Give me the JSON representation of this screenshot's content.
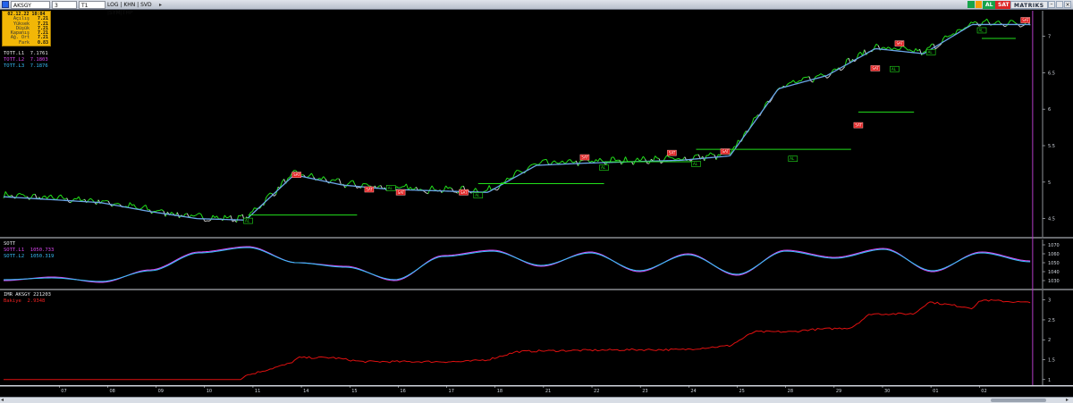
{
  "toolbar": {
    "symbol": "AKSGY",
    "field_a": "3",
    "field_b": "T1",
    "modes": "LOG | KHN | SVD |SYM|THP",
    "buy": "AL",
    "sell": "SAT",
    "brand": "MATRIKS"
  },
  "info": {
    "datetime": "02.12.22 10:04",
    "rows": [
      {
        "k": "Açılış",
        "v": "7.21"
      },
      {
        "k": "Yüksek",
        "v": "7.21"
      },
      {
        "k": "Düşük",
        "v": "7.21"
      },
      {
        "k": "Kapanış",
        "v": "7.21"
      },
      {
        "k": "Ağ. Ort",
        "v": "7.21"
      },
      {
        "k": "Fark",
        "v": "0.83"
      }
    ]
  },
  "legend_main": [
    {
      "name": "TOTT.L1",
      "value": "7.1761",
      "color": "#e8e8e8"
    },
    {
      "name": "TOTT.L2",
      "value": "7.1803",
      "color": "#d946ef"
    },
    {
      "name": "TOTT.L3",
      "value": "7.1876",
      "color": "#38bdf8"
    }
  ],
  "legend_osc": {
    "title": "SOTT",
    "lines": [
      {
        "name": "SOTT.L1",
        "value": "1050.733",
        "color": "#d946ef"
      },
      {
        "name": "SOTT.L2",
        "value": "1050.319",
        "color": "#38bdf8"
      }
    ]
  },
  "legend_bottom": {
    "title": "IMR AKSGY 221203",
    "line": {
      "name": "Bakiye",
      "value": "2.9348",
      "color": "#ef2020"
    }
  },
  "colors": {
    "background": "#000000",
    "up": "#22e01b",
    "down": "#c9c9c9",
    "ma": "#6aa6e8",
    "stop": "#22e01b",
    "sell_marker": "#e11d1d",
    "buy_marker": "#22e01b",
    "equity": "#e01010",
    "cursor": "#b43cc8"
  },
  "chart_data": [
    {
      "type": "line",
      "title": "",
      "y_ticks": [
        "7",
        "6.5",
        "6",
        "5.5",
        "5",
        "4.5"
      ],
      "ylim": [
        4.3,
        7.3
      ],
      "x_labels": [
        "07",
        "08",
        "09",
        "10",
        "11",
        "14",
        "15",
        "16",
        "17",
        "18",
        "21",
        "22",
        "23",
        "24",
        "25",
        "28",
        "29",
        "30",
        "01",
        "02"
      ],
      "series": [
        {
          "name": "TOTT.L1",
          "x": [
            0,
            1,
            2,
            3,
            4,
            5,
            6,
            7,
            8,
            9,
            10,
            11,
            12,
            13,
            14,
            15,
            16,
            17,
            18,
            19,
            20
          ],
          "values": [
            4.82,
            4.78,
            4.74,
            4.62,
            4.52,
            4.5,
            5.12,
            4.98,
            4.92,
            4.9,
            4.88,
            5.25,
            5.28,
            5.3,
            5.32,
            5.38,
            6.3,
            6.48,
            6.85,
            6.78,
            7.18
          ]
        }
      ],
      "markers": [
        {
          "x": 5.05,
          "y": 4.47,
          "label": "AL"
        },
        {
          "x": 6.05,
          "y": 5.1,
          "label": "SAT"
        },
        {
          "x": 7.55,
          "y": 4.9,
          "label": "SAT"
        },
        {
          "x": 8.2,
          "y": 4.86,
          "label": "SAT"
        },
        {
          "x": 8.0,
          "y": 4.92,
          "label": "AL"
        },
        {
          "x": 9.5,
          "y": 4.86,
          "label": "SAT"
        },
        {
          "x": 9.8,
          "y": 4.82,
          "label": "AL"
        },
        {
          "x": 12.0,
          "y": 5.34,
          "label": "SAT"
        },
        {
          "x": 12.4,
          "y": 5.2,
          "label": "AL"
        },
        {
          "x": 13.8,
          "y": 5.4,
          "label": "SAT"
        },
        {
          "x": 14.3,
          "y": 5.25,
          "label": "AL"
        },
        {
          "x": 14.9,
          "y": 5.42,
          "label": "SAT"
        },
        {
          "x": 16.3,
          "y": 5.32,
          "label": "AL"
        },
        {
          "x": 17.65,
          "y": 5.78,
          "label": "SAT"
        },
        {
          "x": 18.0,
          "y": 6.56,
          "label": "SAT"
        },
        {
          "x": 18.5,
          "y": 6.9,
          "label": "SAT"
        },
        {
          "x": 18.4,
          "y": 6.55,
          "label": "AL"
        },
        {
          "x": 19.15,
          "y": 6.78,
          "label": "AL"
        },
        {
          "x": 20.2,
          "y": 7.08,
          "label": "AL"
        },
        {
          "x": 21.1,
          "y": 7.22,
          "label": "SAT"
        }
      ]
    },
    {
      "type": "line",
      "title": "SOTT",
      "y_ticks": [
        "1070",
        "1060",
        "1050",
        "1040",
        "1030"
      ],
      "ylim": [
        1025,
        1072
      ],
      "series": [
        {
          "name": "SOTT.L1",
          "values": [
            1030,
            1034,
            1028,
            1042,
            1062,
            1068,
            1050,
            1046,
            1030,
            1058,
            1064,
            1046,
            1062,
            1040,
            1060,
            1036,
            1064,
            1056,
            1066,
            1040,
            1062,
            1052
          ]
        },
        {
          "name": "SOTT.L2",
          "values": [
            1031,
            1033,
            1029,
            1041,
            1061,
            1067,
            1050,
            1045,
            1031,
            1057,
            1063,
            1047,
            1061,
            1041,
            1059,
            1037,
            1063,
            1055,
            1065,
            1041,
            1061,
            1051
          ]
        }
      ]
    },
    {
      "type": "line",
      "title": "IMR AKSGY 221203",
      "y_ticks": [
        "3",
        "2.5",
        "2",
        "1.5",
        "1"
      ],
      "ylim": [
        0.95,
        3.15
      ],
      "series": [
        {
          "name": "Bakiye",
          "x": [
            0,
            4.9,
            5.0,
            5.9,
            6.1,
            6.8,
            7.4,
            9.5,
            10.0,
            10.6,
            11.1,
            13.0,
            14.0,
            15.0,
            15.5,
            16.3,
            16.6,
            17.5,
            17.9,
            18.8,
            19.1,
            20.0,
            20.2,
            21.2
          ],
          "values": [
            1.0,
            1.0,
            1.1,
            1.4,
            1.55,
            1.55,
            1.45,
            1.45,
            1.5,
            1.7,
            1.72,
            1.75,
            1.75,
            1.85,
            2.2,
            2.2,
            2.25,
            2.3,
            2.65,
            2.65,
            2.95,
            2.8,
            3.0,
            2.93
          ]
        }
      ]
    }
  ]
}
